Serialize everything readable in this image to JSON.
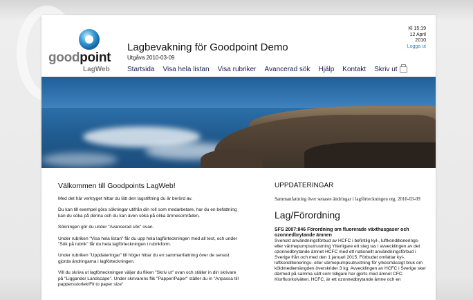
{
  "header": {
    "logo_word_light": "good",
    "logo_word_strong": "point",
    "logo_sub": "LagWeb",
    "title": "Lagbevakning för Goodpoint Demo",
    "edition": "Utgåva 2010-03-09",
    "nav": [
      "Startsida",
      "Visa hela listan",
      "Visa rubriker",
      "Avancerad sök",
      "Hjälp",
      "Kontakt",
      "Skriv ut"
    ],
    "time": "Kl 15:19",
    "date_line1": "12 April",
    "date_line2": "2010",
    "logout": "Logga ut"
  },
  "welcome": {
    "title": "Välkommen till Goodpoints LagWeb!",
    "paragraphs": [
      "Med det här verktyget hittar du lätt den lagstiftning du är berörd av.",
      "Du kan till exempel göra sökningar utifrån din roll som medarbetare, har du en befattning kan du söka på denna och du kan även söka på olika ämnesområden.",
      "Sökningen gör du under \"Avancerad sök\" ovan.",
      "Under rubriken \"Visa hela listan\" får du upp hela lagförteckningen med all text, och under \"Sök på rubrik\" får du hela lagförteckningen i rubrikform.",
      "Under rubriken \"Uppdateringar\" till höger hittar du en sammanfattning över de senast gjorda ändringarna i lagförteckningen.",
      "Vill du skriva ut lagförteckningen väljer du fliken \"Skriv ut\" ovan och ställer in din skrivare på \"Liggande/ Landscape\". Under skrivarens flik \"Papper/Paper\" ställer du in \"Anpassa till pappersstorlek/Fit to paper size\""
    ]
  },
  "updates": {
    "title": "UPPDATERINGAR",
    "summary": "Sammanfattning över senaste ändringar i lagförteckningen utg. 2010-03-09",
    "section_title": "Lag/Förordning",
    "item_title": "SFS 2007:846 Förordning om fluorerade växthusgaser och ozonnedbrytande ämnen",
    "item_body": "Svenskt användningsförbud av HCFC i befintlig kyl-, luftkonditionerings- eller värmepumpsutrustning Ytterligare ett steg tas i avvecklingen av det ozonnedbrytande ämnet HCFC med ett nationellt användningsförbud i Sverige från och med den 1 januari 2015. Förbudet omfattar kyl-, luftkonditionerings- eller värmepumpsutrustning för yrkesmässigt bruk om köldmediemängden överskrider 3 kg. Avvecklingen av HCFC i Sverige sker därmed på samma sätt som tidigare har gjorts med ämnet CFC. Klorfluorkolväten, HCFC, är ett ozonnedbrytande ämne och en"
  }
}
